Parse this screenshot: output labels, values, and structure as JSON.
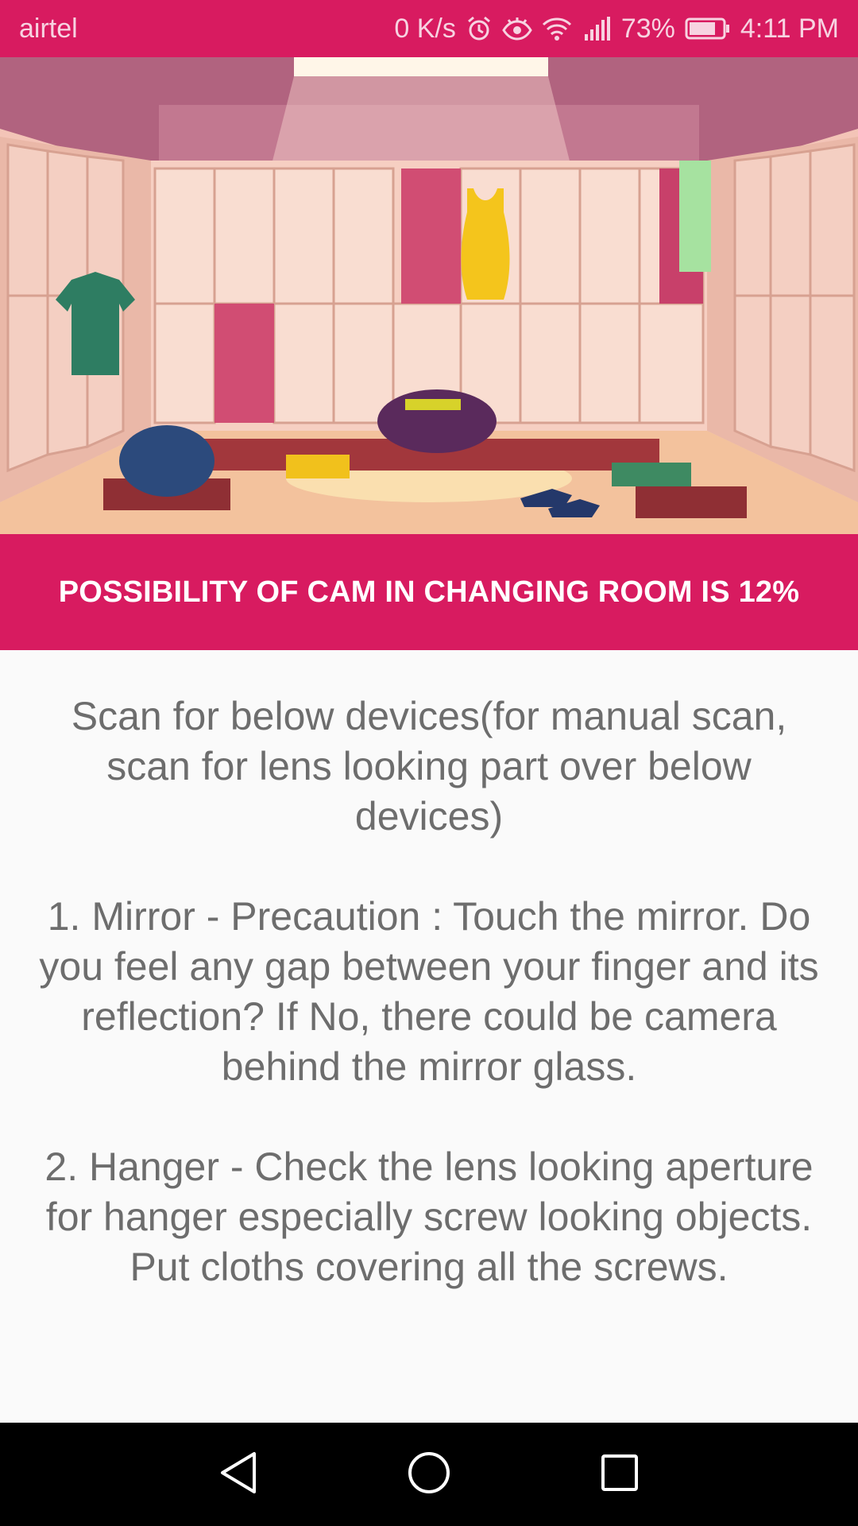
{
  "status_bar": {
    "carrier": "airtel",
    "net_speed": "0 K/s",
    "battery_pct": "73%",
    "time": "4:11 PM",
    "icons": [
      "alarm-icon",
      "eye-icon",
      "wifi-icon",
      "signal-icon",
      "battery-icon"
    ]
  },
  "hero": {
    "image": "changing-room-illustration"
  },
  "banner": {
    "text": "POSSIBILITY OF CAM IN CHANGING ROOM IS 12%"
  },
  "content": {
    "intro": "Scan for below devices(for manual scan, scan for lens looking part over below devices)",
    "items": [
      "1. Mirror - Precaution : Touch the mirror. Do you feel any gap between your finger and its reflection? If No, there could be camera behind the mirror glass.",
      "2. Hanger - Check the lens looking aperture for hanger especially screw looking objects. Put cloths covering all the screws."
    ]
  },
  "nav": {
    "icons": [
      "back-icon",
      "home-icon",
      "recents-icon"
    ]
  },
  "colors": {
    "accent": "#d81b60",
    "text": "#6d6d6d",
    "background": "#fafafa"
  }
}
